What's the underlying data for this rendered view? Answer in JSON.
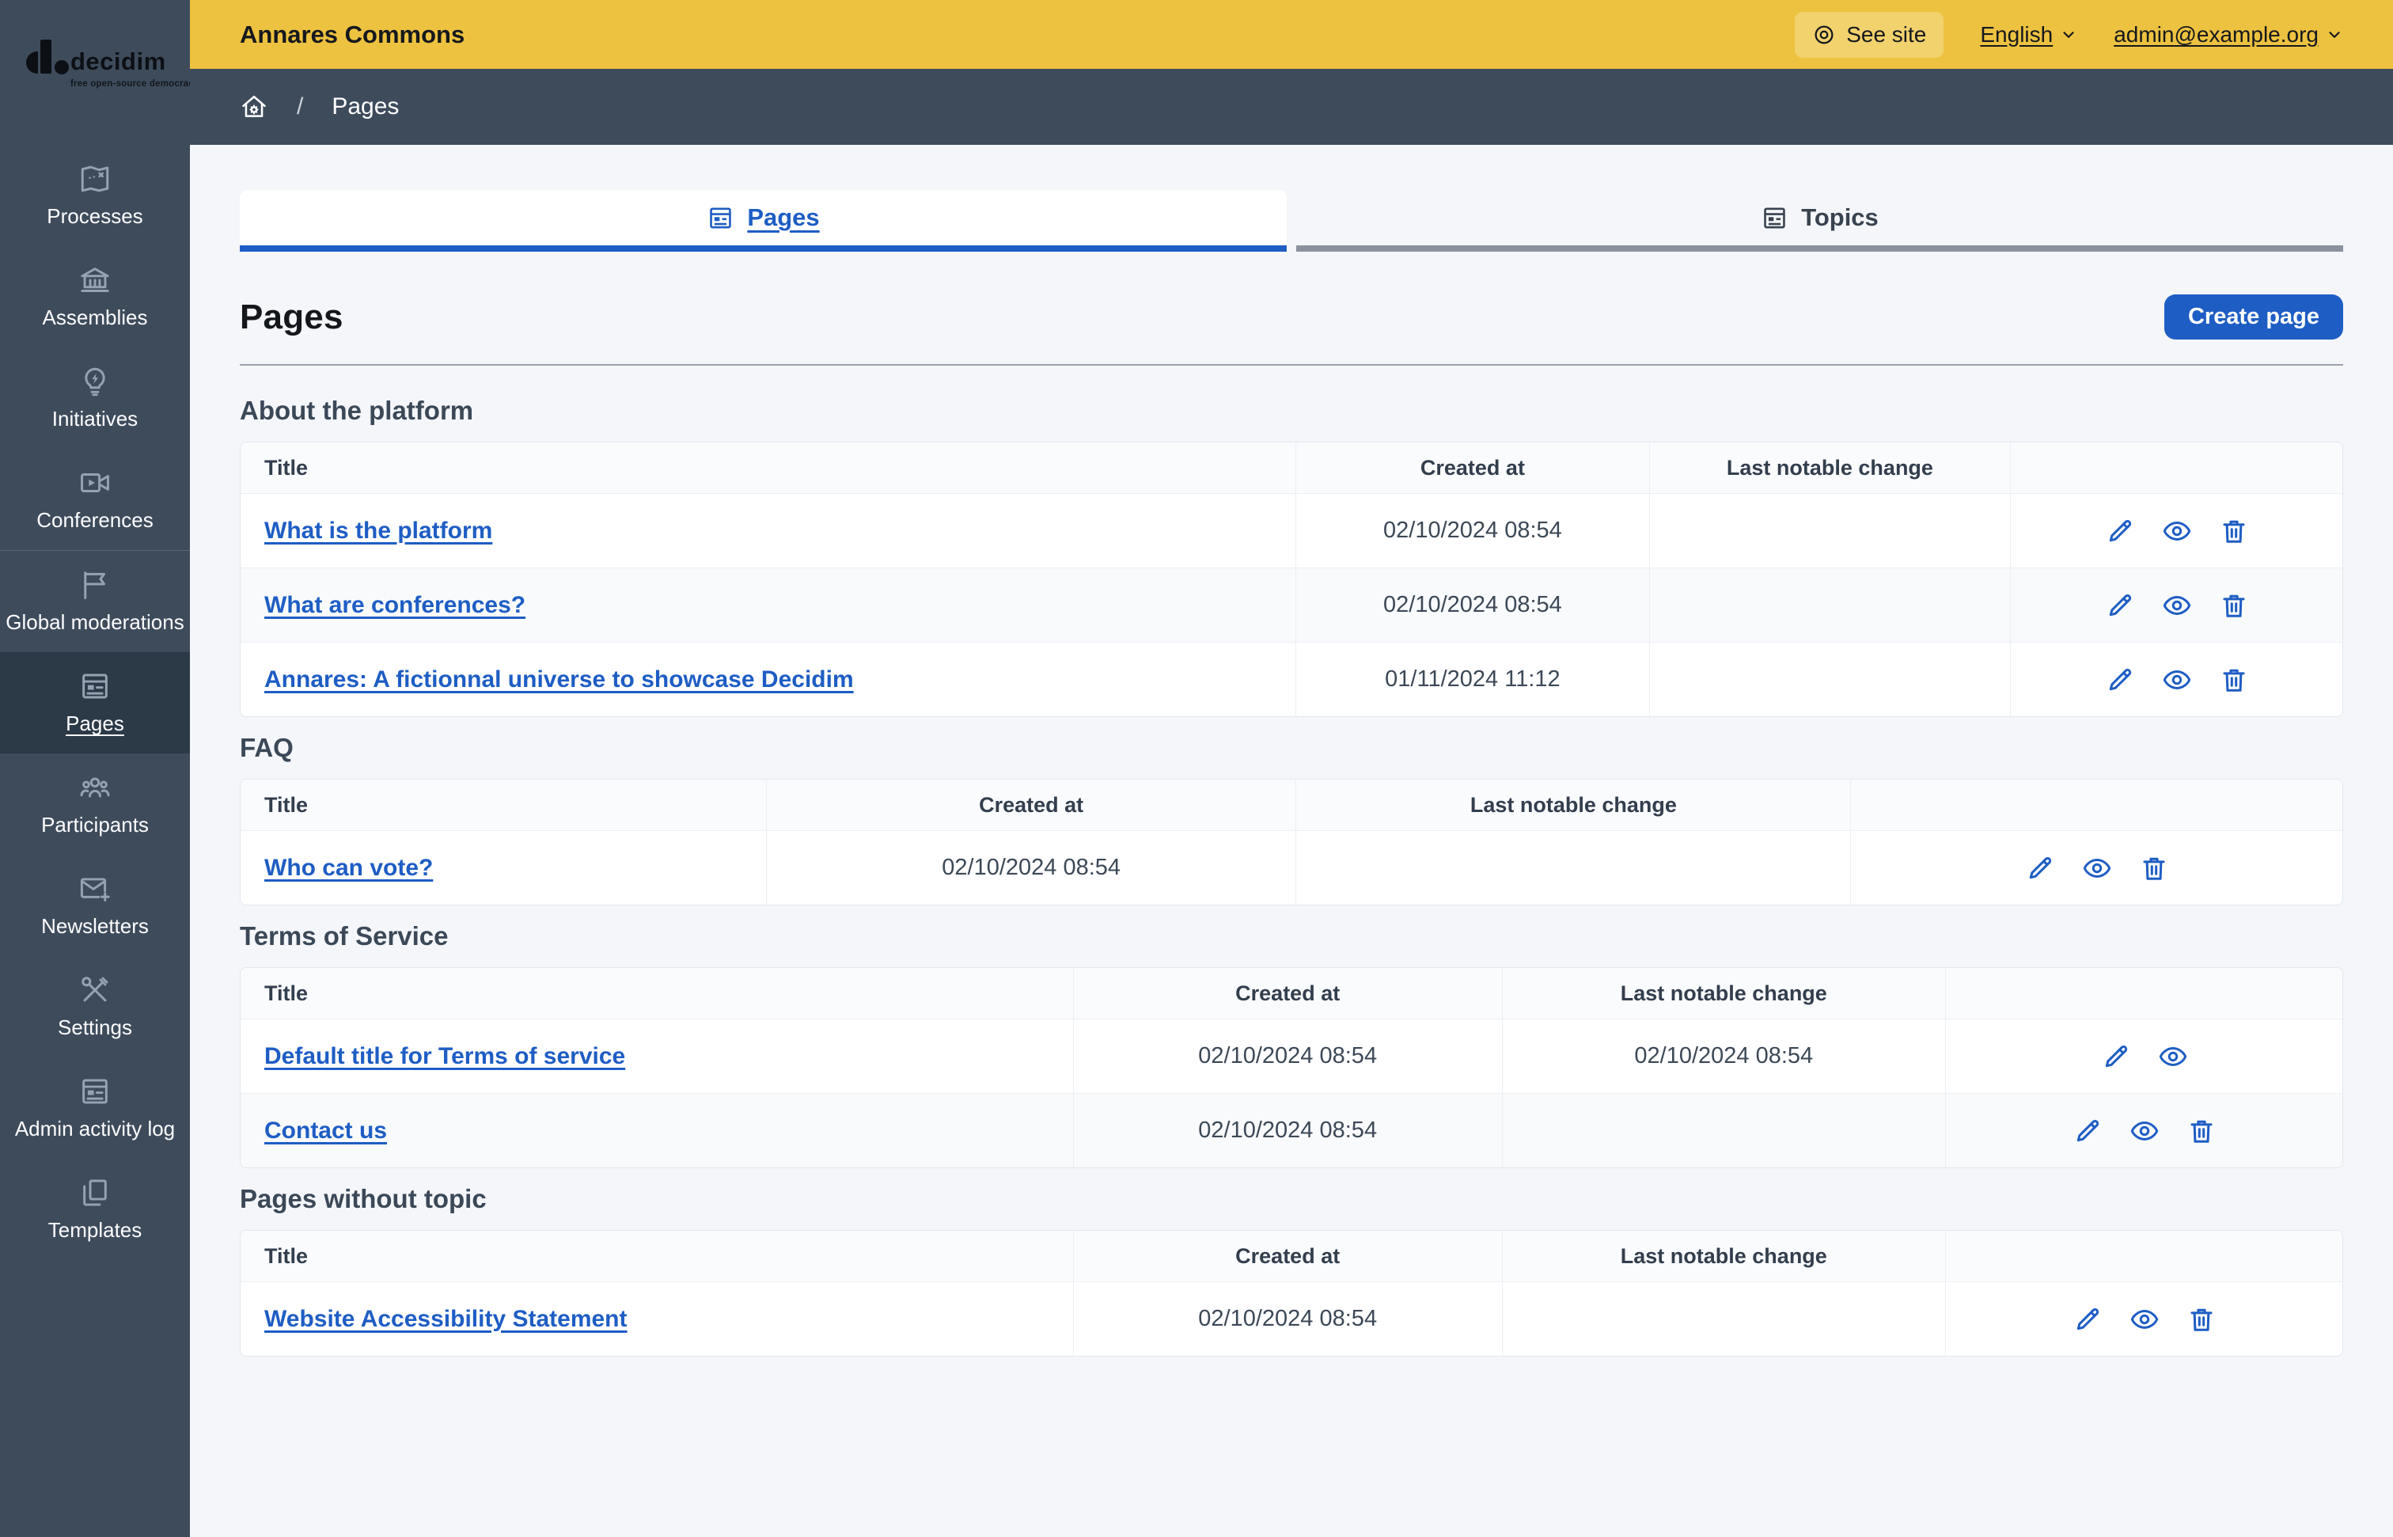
{
  "logo": {
    "brand": "decidim",
    "tagline": "free open-source democracy"
  },
  "topbar": {
    "org_name": "Annares Commons",
    "see_site_label": "See site",
    "language_label": "English",
    "user_email": "admin@example.org"
  },
  "breadcrumb": {
    "current": "Pages"
  },
  "sidebar": {
    "groups": [
      {
        "items": [
          {
            "label": "Processes",
            "icon": "treasure-map-icon"
          },
          {
            "label": "Assemblies",
            "icon": "government-building-icon"
          },
          {
            "label": "Initiatives",
            "icon": "lightbulb-flash-icon"
          },
          {
            "label": "Conferences",
            "icon": "video-camera-icon"
          }
        ]
      },
      {
        "items": [
          {
            "label": "Global moderations",
            "icon": "flag-icon"
          },
          {
            "label": "Pages",
            "icon": "article-icon",
            "active": true
          },
          {
            "label": "Participants",
            "icon": "team-icon"
          },
          {
            "label": "Newsletters",
            "icon": "mail-add-icon"
          },
          {
            "label": "Settings",
            "icon": "tools-icon"
          },
          {
            "label": "Admin activity log",
            "icon": "article-icon"
          },
          {
            "label": "Templates",
            "icon": "file-copy-icon"
          }
        ]
      }
    ]
  },
  "tabs": [
    {
      "label": "Pages",
      "active": true
    },
    {
      "label": "Topics",
      "active": false
    }
  ],
  "page": {
    "title": "Pages",
    "create_button_label": "Create page"
  },
  "table_columns": {
    "title": "Title",
    "created_at": "Created at",
    "last_change": "Last notable change"
  },
  "sections": [
    {
      "heading": "About the platform",
      "layout": "wide",
      "rows": [
        {
          "title": "What is the platform",
          "created_at": "02/10/2024 08:54",
          "last_change": "",
          "actions": [
            "edit",
            "preview",
            "delete"
          ]
        },
        {
          "title": "What are conferences?",
          "created_at": "02/10/2024 08:54",
          "last_change": "",
          "actions": [
            "edit",
            "preview",
            "delete"
          ]
        },
        {
          "title": "Annares: A fictionnal universe to showcase Decidim",
          "created_at": "01/11/2024 11:12",
          "last_change": "",
          "actions": [
            "edit",
            "preview",
            "delete"
          ]
        }
      ]
    },
    {
      "heading": "FAQ",
      "layout": "narrow",
      "rows": [
        {
          "title": "Who can vote?",
          "created_at": "02/10/2024 08:54",
          "last_change": "",
          "actions": [
            "edit",
            "preview",
            "delete"
          ]
        }
      ]
    },
    {
      "heading": "Terms of Service",
      "layout": "medium",
      "rows": [
        {
          "title": "Default title for Terms of service",
          "created_at": "02/10/2024 08:54",
          "last_change": "02/10/2024 08:54",
          "actions": [
            "edit",
            "preview"
          ]
        },
        {
          "title": "Contact us",
          "created_at": "02/10/2024 08:54",
          "last_change": "",
          "actions": [
            "edit",
            "preview",
            "delete"
          ]
        }
      ]
    },
    {
      "heading": "Pages without topic",
      "layout": "medium",
      "rows": [
        {
          "title": "Website Accessibility Statement",
          "created_at": "02/10/2024 08:54",
          "last_change": "",
          "actions": [
            "edit",
            "preview",
            "delete"
          ]
        }
      ]
    }
  ],
  "colors": {
    "accent_blue": "#1e5dc4",
    "topbar_yellow": "#edc240",
    "sidebar_dark": "#3e4b5b",
    "sidebar_active": "#2c3947",
    "background": "#f4f6f9",
    "inactive_tab_bar": "#8b929d"
  }
}
